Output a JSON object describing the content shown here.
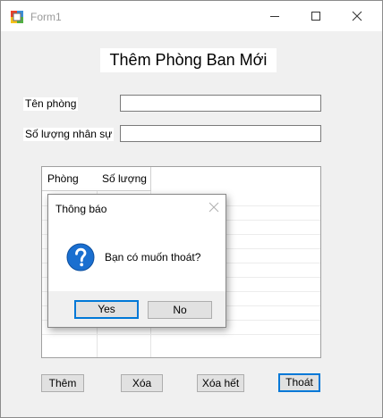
{
  "window": {
    "title": "Form1"
  },
  "form": {
    "heading": "Thêm Phòng Ban Mới",
    "fields": [
      {
        "label": "Tên phòng",
        "value": ""
      },
      {
        "label": "Số lượng nhân sự",
        "value": ""
      }
    ],
    "grid": {
      "columns": [
        "Phòng",
        "Số lượng"
      ],
      "rows": []
    },
    "buttons": {
      "add": "Thêm",
      "delete": "Xóa",
      "delete_all": "Xóa hết",
      "exit": "Thoát"
    }
  },
  "dialog": {
    "title": "Thông báo",
    "icon": "question-icon",
    "message": "Bạn có muốn thoát?",
    "yes_label": "Yes",
    "no_label": "No"
  },
  "colors": {
    "accent": "#0078d7",
    "window_bg": "#f0f0f0",
    "title_text": "#9a9a9a"
  }
}
